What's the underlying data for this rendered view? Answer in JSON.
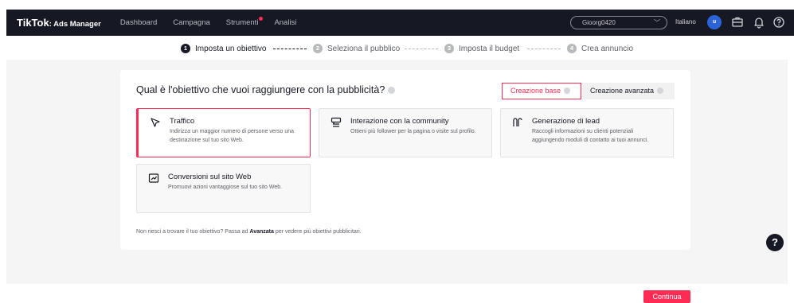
{
  "header": {
    "logo_brand": "TikTok",
    "logo_sub": ": Ads Manager",
    "nav": [
      {
        "label": "Dashboard"
      },
      {
        "label": "Campagna"
      },
      {
        "label": "Strumenti"
      },
      {
        "label": "Analisi"
      }
    ],
    "account_value": "Gioorg0420",
    "language": "Italiano",
    "avatar_letter": "u",
    "icons": [
      "briefcase-icon",
      "bell-icon",
      "help-circle-icon"
    ]
  },
  "steps": [
    {
      "num": "1",
      "label": "Imposta un obiettivo"
    },
    {
      "num": "2",
      "label": "Seleziona il pubblico"
    },
    {
      "num": "3",
      "label": "Imposta il budget"
    },
    {
      "num": "4",
      "label": "Crea annuncio"
    }
  ],
  "main": {
    "question": "Qual è l'obiettivo che vuoi raggiungere con la pubblicità?",
    "mode_base": "Creazione base",
    "mode_advanced": "Creazione avanzata",
    "objectives": [
      {
        "title": "Traffico",
        "desc": "Indirizza un maggior numero di persone verso una destinazione sul tuo sito Web.",
        "icon": "cursor-icon"
      },
      {
        "title": "Interazione con la community",
        "desc": "Ottieni più follower per la pagina o visite sul profilo.",
        "icon": "community-icon"
      },
      {
        "title": "Generazione di lead",
        "desc": "Raccogli informazioni su clienti potenziali aggiungendo moduli di contatto ai tuoi annunci.",
        "icon": "lead-icon"
      },
      {
        "title": "Conversioni sul sito Web",
        "desc": "Promuovi azioni vantaggiose sul tuo sito Web.",
        "icon": "trend-icon"
      }
    ],
    "hint_before": "Non riesci a trovare il tuo obiettivo? Passa ad ",
    "hint_bold": "Avanzata",
    "hint_after": " per vedere più obiettivi pubblicitari."
  },
  "footer": {
    "continue_label": "Continua"
  },
  "colors": {
    "accent": "#fe2c55",
    "topbar": "#161823",
    "avatar": "#2b63d9"
  }
}
